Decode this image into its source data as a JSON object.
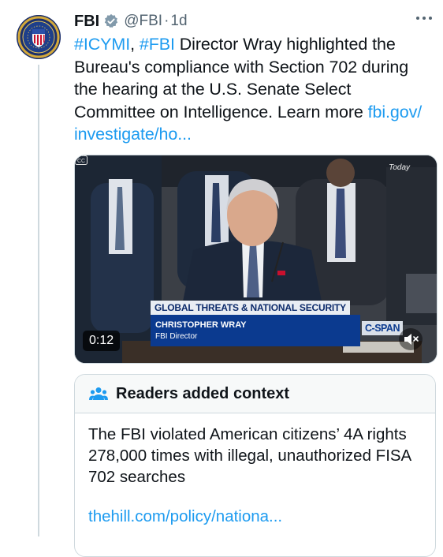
{
  "tweet": {
    "author_name": "FBI",
    "handle": "@FBI",
    "separator": "·",
    "time": "1d",
    "avatar_icon": "fbi-seal-icon",
    "verified_icon": "verified-badge-icon",
    "more_icon": "more-options-icon",
    "text": {
      "hashtag1": "#ICYMI",
      "comma": ", ",
      "hashtag2": "#FBI",
      "body": " Director Wray highlighted the Bureau's compliance with Section 702 during the hearing at the U.S. Senate Select Committee on Intelligence. Learn more ",
      "link": "fbi.gov/ investigate/ho..."
    }
  },
  "video": {
    "today_label": "Today",
    "chyron_top": "GLOBAL THREATS & NATIONAL SECURITY",
    "chyron_name": "CHRISTOPHER WRAY",
    "chyron_title": "FBI Director",
    "network": "C-SPAN",
    "duration": "0:12",
    "mute_icon": "mute-icon",
    "cc_icon": "captions-icon"
  },
  "context_note": {
    "title": "Readers added context",
    "icon": "people-icon",
    "body": "The FBI violated American citizens’ 4A rights 278,000 times with illegal, unauthorized FISA 702 searches",
    "link": "thehill.com/policy/nationa..."
  },
  "colors": {
    "link": "#1d9bf0",
    "secondary_text": "#536471",
    "border": "#cfd9de",
    "chyron_blue": "#0b3a8f"
  }
}
